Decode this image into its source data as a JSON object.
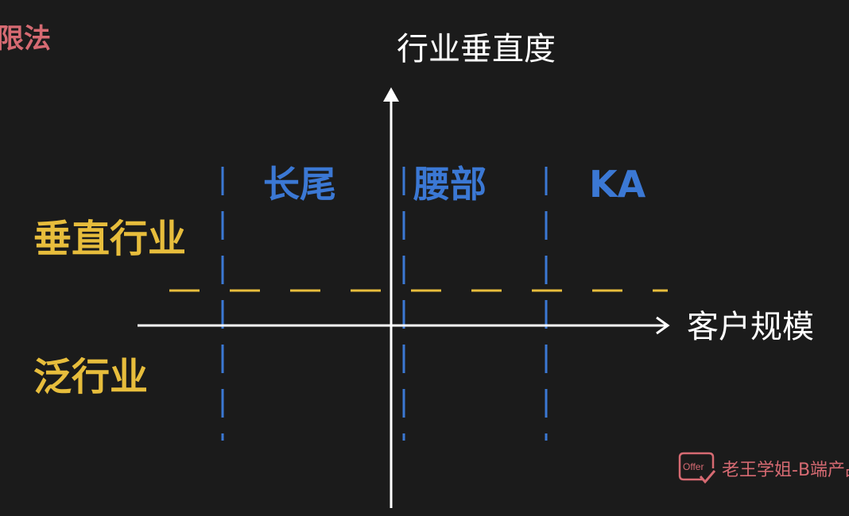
{
  "corner_title": "限法",
  "axes": {
    "y_label": "行业垂直度",
    "x_label": "客户规模"
  },
  "segments": {
    "long_tail": "长尾",
    "mid": "腰部",
    "ka": "KA"
  },
  "industries": {
    "vertical": "垂直行业",
    "general": "泛行业"
  },
  "watermark": {
    "icon_text": "Offer",
    "text": "老王学姐-B端产品"
  },
  "colors": {
    "background": "#1b1b1b",
    "axis": "#ffffff",
    "segment_blue": "#3b78d4",
    "industry_yellow": "#e7bd3c",
    "accent_red": "#d66a72"
  }
}
